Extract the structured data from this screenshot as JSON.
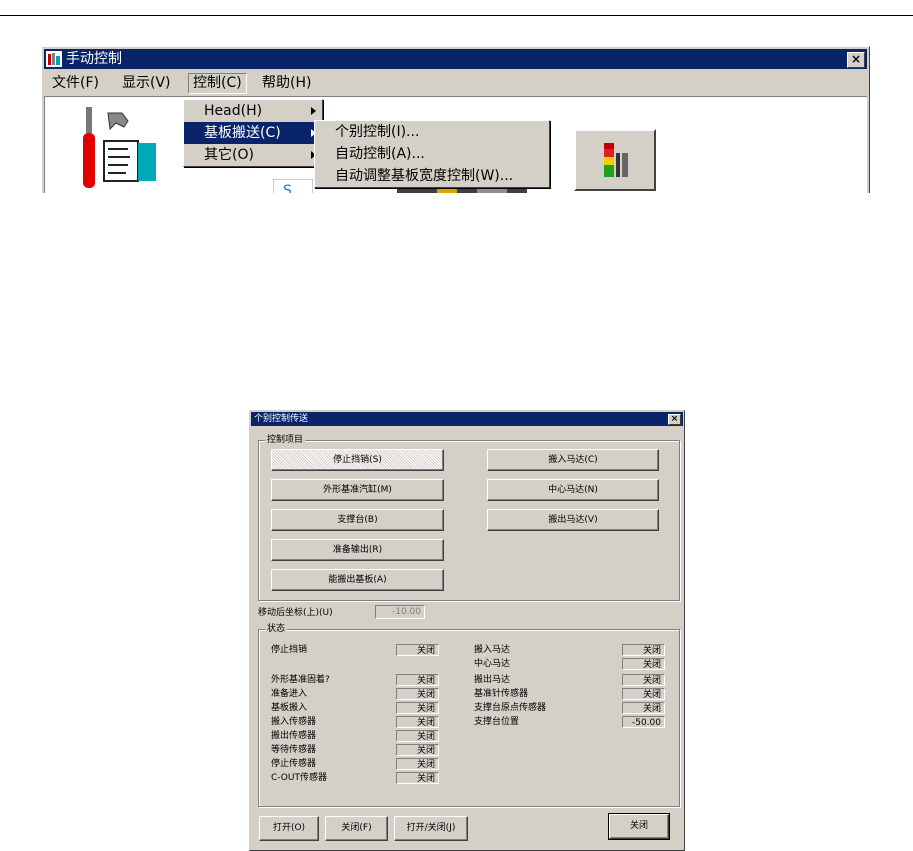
{
  "window": {
    "title": "手动控制",
    "close": "×",
    "menu": [
      "文件(F)",
      "显示(V)",
      "控制(C)",
      "帮助(H)"
    ]
  },
  "control_menu": {
    "items": [
      "Head(H)",
      "基板搬送(C)",
      "其它(O)"
    ]
  },
  "conveyor_submenu": {
    "items": [
      "个别控制(I)...",
      "自动控制(A)...",
      "自动调整基板宽度控制(W)..."
    ]
  },
  "dialog": {
    "title": "个别控制传送",
    "close": "×",
    "control_group": "控制项目",
    "left_buttons": [
      "停止挡销(S)",
      "外形基准汽缸(M)",
      "支撑台(B)",
      "准备输出(R)",
      "能搬出基板(A)"
    ],
    "right_buttons": [
      "搬入马达(C)",
      "中心马达(N)",
      "搬出马达(V)"
    ],
    "move_coord_label": "移动后坐标(上)(U)",
    "move_coord_value": "-10.00",
    "status_group": "状态",
    "status_left": [
      {
        "label": "停止挡销",
        "value": "关闭"
      },
      {
        "label": "外形基准固着?",
        "value": "关闭"
      },
      {
        "label": "准备进入",
        "value": "关闭"
      },
      {
        "label": "基板搬入",
        "value": "关闭"
      },
      {
        "label": "搬入传感器",
        "value": "关闭"
      },
      {
        "label": "搬出传感器",
        "value": "关闭"
      },
      {
        "label": "等待传感器",
        "value": "关闭"
      },
      {
        "label": "停止传感器",
        "value": "关闭"
      },
      {
        "label": "C-OUT传感器",
        "value": "关闭"
      }
    ],
    "status_right": [
      {
        "label": "搬入马达",
        "value": "关闭"
      },
      {
        "label": "中心马达",
        "value": "关闭"
      },
      {
        "label": "搬出马达",
        "value": "关闭"
      },
      {
        "label": "基准针传感器",
        "value": "关闭"
      },
      {
        "label": "支撑台原点传感器",
        "value": "关闭"
      },
      {
        "label": "支撑台位置",
        "value": "-50.00"
      }
    ],
    "bottom_buttons": [
      "打开(O)",
      "关闭(F)",
      "打开/关闭(J)"
    ],
    "close_button": "关闭"
  }
}
